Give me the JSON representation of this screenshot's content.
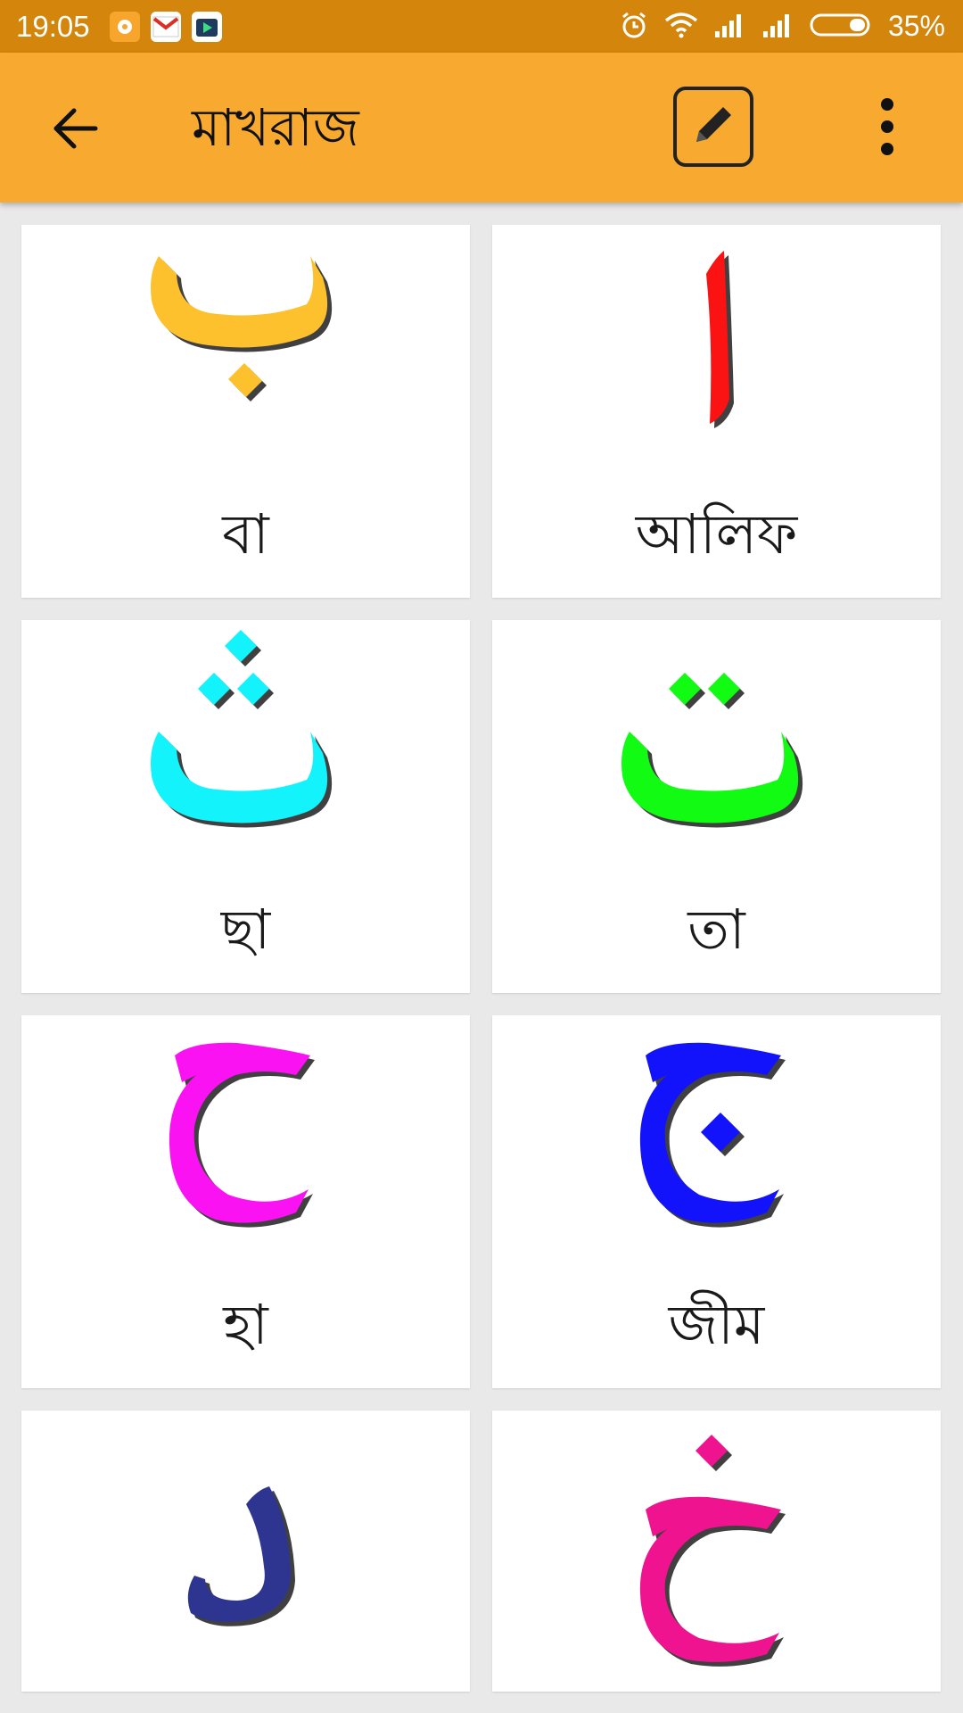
{
  "status_bar": {
    "time": "19:05",
    "battery": "35%",
    "icons": [
      "chat-notification-icon",
      "gmail-icon",
      "play-store-icon",
      "alarm-icon",
      "wifi-icon",
      "signal-icon",
      "signal-icon",
      "battery-icon"
    ]
  },
  "app_bar": {
    "title": "মাখরাজ",
    "back_icon": "arrow-back-icon",
    "edit_icon": "pencil-icon",
    "menu_icon": "more-vert-icon",
    "color": "#f7a930",
    "status_color": "#d4860c"
  },
  "letters": [
    {
      "arabic": "ب",
      "label": "বা",
      "color": "#fdc12e"
    },
    {
      "arabic": "ا",
      "label": "আলিফ",
      "color": "#fb1212"
    },
    {
      "arabic": "ث",
      "label": "ছা",
      "color": "#12f3fb"
    },
    {
      "arabic": "ت",
      "label": "তা",
      "color": "#12fb12"
    },
    {
      "arabic": "ح",
      "label": "হা",
      "color": "#fb12f3"
    },
    {
      "arabic": "ج",
      "label": "জীম",
      "color": "#1212fb"
    },
    {
      "arabic": "د",
      "label": "",
      "color": "#2e3591"
    },
    {
      "arabic": "خ",
      "label": "",
      "color": "#ef1390"
    }
  ]
}
